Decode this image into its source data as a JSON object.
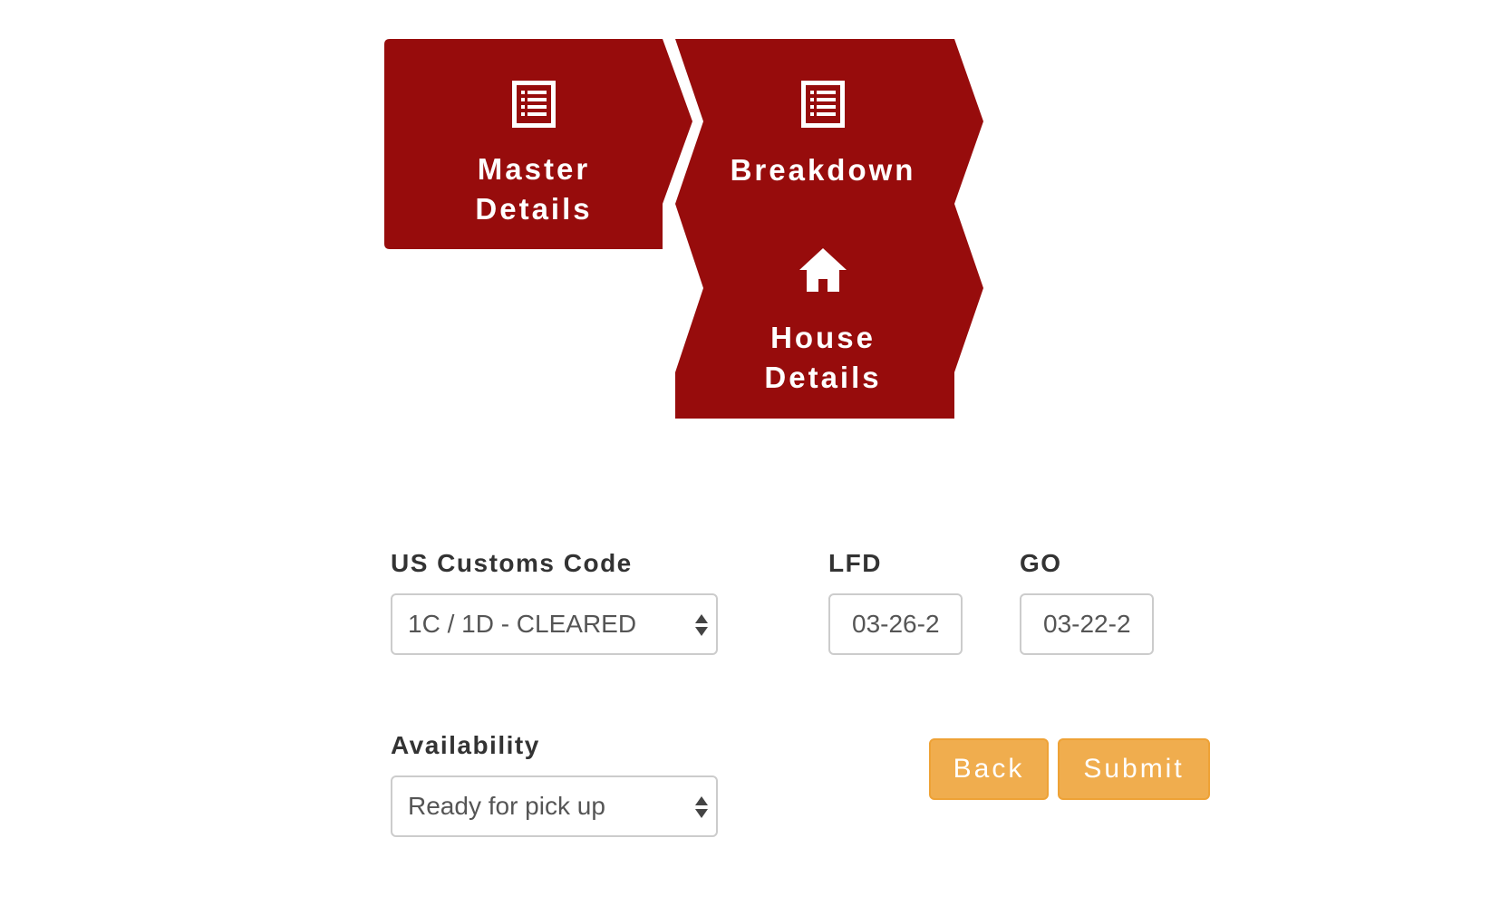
{
  "wizard": {
    "accent_color": "#970c0c",
    "steps": [
      {
        "label": "Master\nDetails",
        "icon": "list-icon"
      },
      {
        "label": "Breakdown",
        "icon": "list-icon"
      },
      {
        "label": "House\nDetails",
        "icon": "home-icon"
      }
    ]
  },
  "form": {
    "customs": {
      "label": "US Customs Code",
      "value": "1C / 1D - CLEARED"
    },
    "lfd": {
      "label": "LFD",
      "value": "03-26-2"
    },
    "go": {
      "label": "GO",
      "value": "03-22-2"
    },
    "availability": {
      "label": "Availability",
      "value": "Ready for pick up"
    }
  },
  "buttons": {
    "back_label": "Back",
    "submit_label": "Submit",
    "color": "#f0ad4e"
  }
}
